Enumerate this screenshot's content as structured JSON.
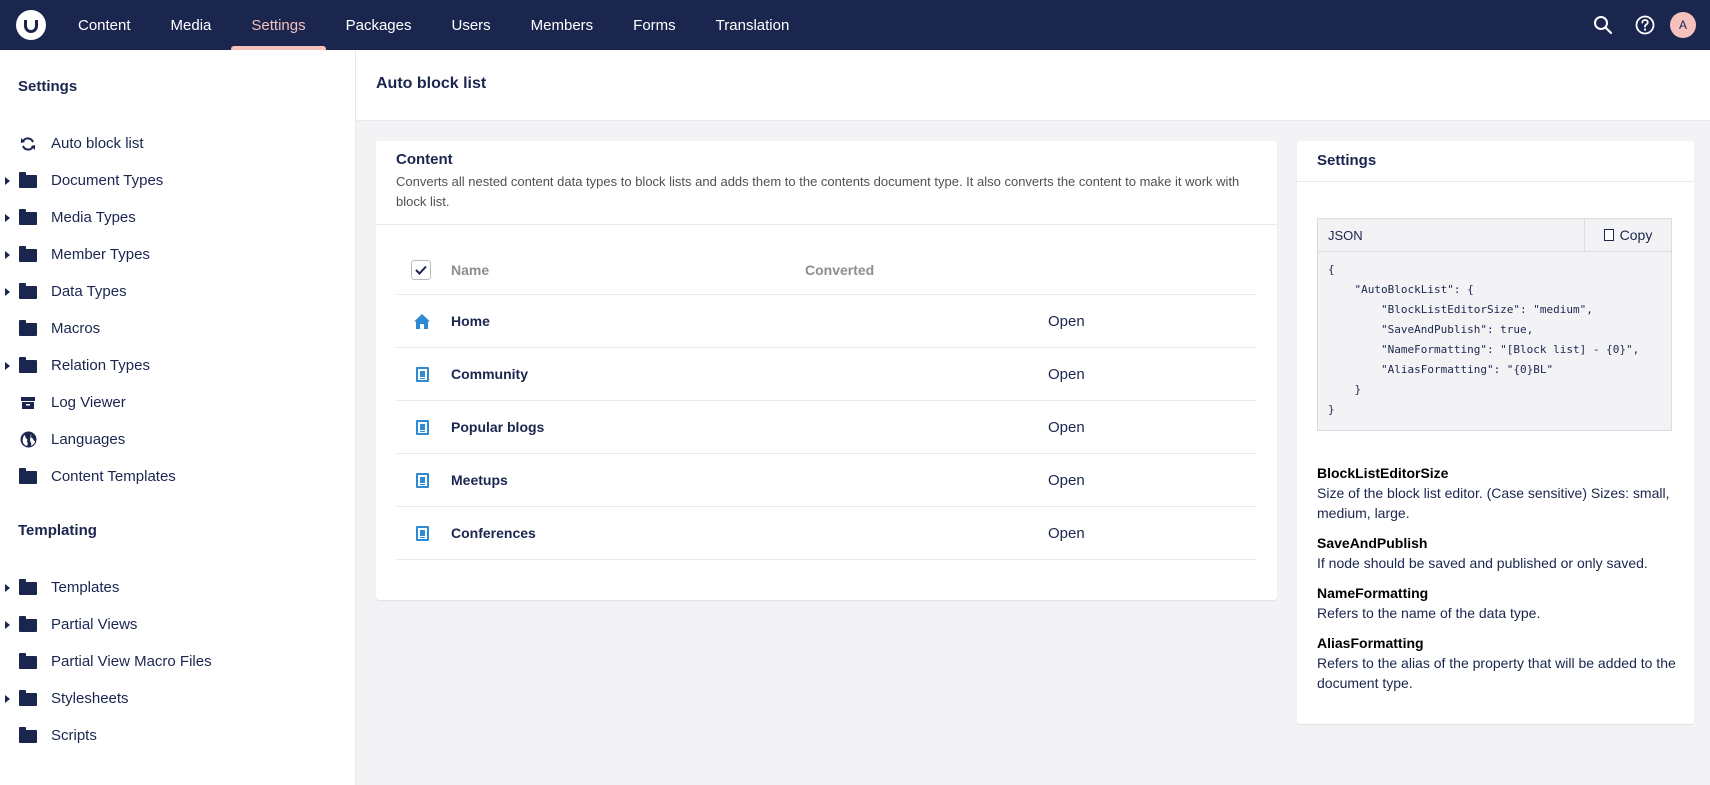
{
  "topbar": {
    "nav": [
      "Content",
      "Media",
      "Settings",
      "Packages",
      "Users",
      "Members",
      "Forms",
      "Translation"
    ],
    "active": "Settings",
    "avatar_initial": "A"
  },
  "sidebar": {
    "settings_heading": "Settings",
    "settings_items": [
      {
        "label": "Auto block list",
        "icon": "sync-icon",
        "expandable": false
      },
      {
        "label": "Document Types",
        "icon": "folder-icon",
        "expandable": true
      },
      {
        "label": "Media Types",
        "icon": "folder-icon",
        "expandable": true
      },
      {
        "label": "Member Types",
        "icon": "folder-icon",
        "expandable": true
      },
      {
        "label": "Data Types",
        "icon": "folder-icon",
        "expandable": true
      },
      {
        "label": "Macros",
        "icon": "folder-icon",
        "expandable": false
      },
      {
        "label": "Relation Types",
        "icon": "folder-icon",
        "expandable": true
      },
      {
        "label": "Log Viewer",
        "icon": "box-icon",
        "expandable": false
      },
      {
        "label": "Languages",
        "icon": "globe-icon",
        "expandable": false
      },
      {
        "label": "Content Templates",
        "icon": "folder-icon",
        "expandable": false
      }
    ],
    "templating_heading": "Templating",
    "templating_items": [
      {
        "label": "Templates",
        "icon": "folder-icon",
        "expandable": true
      },
      {
        "label": "Partial Views",
        "icon": "folder-icon",
        "expandable": true
      },
      {
        "label": "Partial View Macro Files",
        "icon": "folder-icon",
        "expandable": false
      },
      {
        "label": "Stylesheets",
        "icon": "folder-icon",
        "expandable": true
      },
      {
        "label": "Scripts",
        "icon": "folder-icon",
        "expandable": false
      }
    ]
  },
  "main": {
    "title": "Auto block list",
    "content_panel": {
      "title": "Content",
      "description": "Converts all nested content data types to block lists and adds them to the contents document type. It also converts the content to make it work with block list.",
      "columns": [
        "Name",
        "Converted"
      ],
      "rows": [
        {
          "name": "Home",
          "icon": "home-icon",
          "status": "Open"
        },
        {
          "name": "Community",
          "icon": "document-icon",
          "status": "Open"
        },
        {
          "name": "Popular blogs",
          "icon": "document-icon",
          "status": "Open"
        },
        {
          "name": "Meetups",
          "icon": "document-icon",
          "status": "Open"
        },
        {
          "name": "Conferences",
          "icon": "document-icon",
          "status": "Open"
        }
      ]
    },
    "settings_panel": {
      "title": "Settings",
      "json_label": "JSON",
      "copy_label": "Copy",
      "json_code": "{\n    \"AutoBlockList\": {\n        \"BlockListEditorSize\": \"medium\",\n        \"SaveAndPublish\": true,\n        \"NameFormatting\": \"[Block list] - {0}\",\n        \"AliasFormatting\": \"{0}BL\"\n    }\n}",
      "help": [
        {
          "title": "BlockListEditorSize",
          "text": "Size of the block list editor. (Case sensitive) Sizes: small, medium, large."
        },
        {
          "title": "SaveAndPublish",
          "text": "If node should be saved and published or only saved."
        },
        {
          "title": "NameFormatting",
          "text": "Refers to the name of the data type."
        },
        {
          "title": "AliasFormatting",
          "text": "Refers to the alias of the property that will be added to the document type."
        }
      ]
    }
  },
  "colors": {
    "nav_bg": "#1b264f",
    "accent": "#f5c1bc",
    "icon_blue": "#2e8bd3"
  }
}
